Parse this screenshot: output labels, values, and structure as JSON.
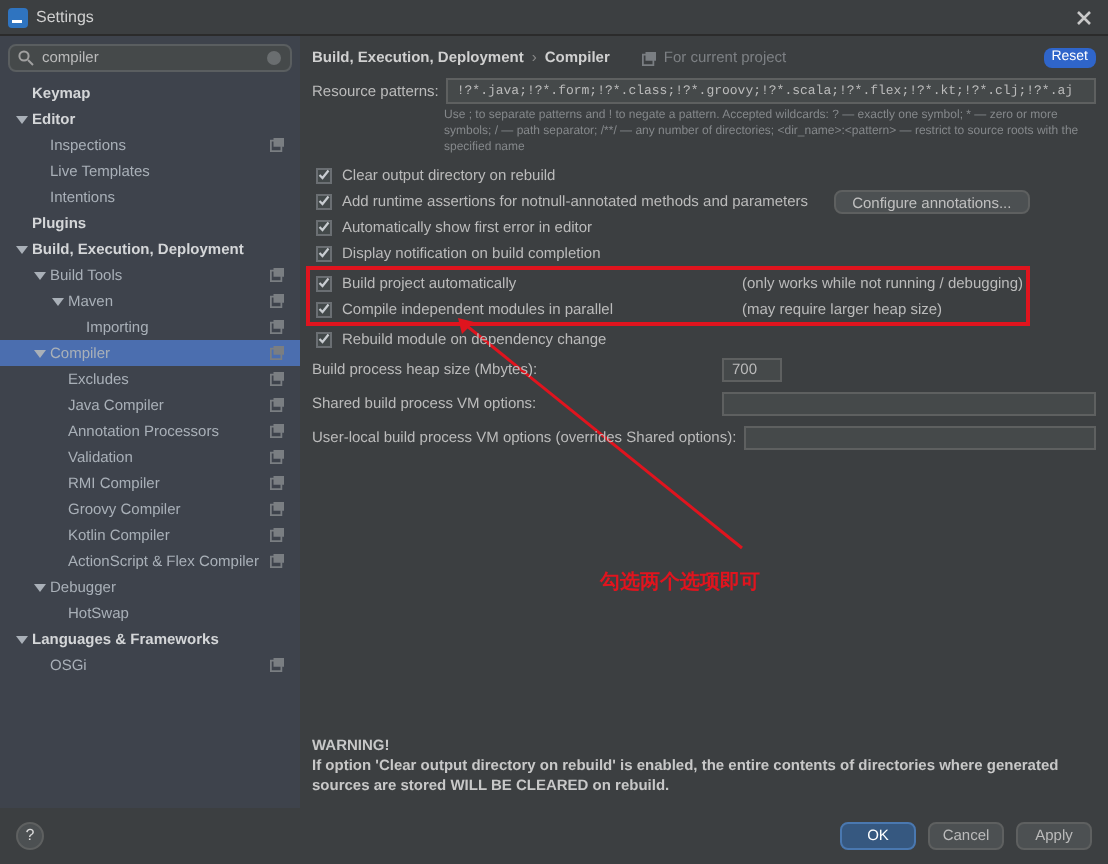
{
  "window": {
    "title": "Settings"
  },
  "search": {
    "value": "compiler"
  },
  "sidebar": {
    "items": [
      {
        "label": "Keymap",
        "bold": true,
        "selected": false,
        "project": false
      },
      {
        "label": "Editor",
        "bold": true,
        "selected": false,
        "project": false,
        "expanded": true,
        "children": [
          {
            "label": "Inspections",
            "selected": false,
            "project": true
          },
          {
            "label": "Live Templates",
            "selected": false,
            "project": false
          },
          {
            "label": "Intentions",
            "selected": false,
            "project": false
          }
        ]
      },
      {
        "label": "Plugins",
        "bold": true,
        "selected": false,
        "project": false
      },
      {
        "label": "Build, Execution, Deployment",
        "bold": true,
        "selected": false,
        "project": false,
        "expanded": true,
        "children": [
          {
            "label": "Build Tools",
            "selected": false,
            "project": true,
            "expanded": true,
            "children": [
              {
                "label": "Maven",
                "selected": false,
                "project": true,
                "expanded": true,
                "children": [
                  {
                    "label": "Importing",
                    "selected": false,
                    "project": true
                  }
                ]
              }
            ]
          },
          {
            "label": "Compiler",
            "selected": true,
            "project": true,
            "expanded": true,
            "children": [
              {
                "label": "Excludes",
                "selected": false,
                "project": true
              },
              {
                "label": "Java Compiler",
                "selected": false,
                "project": true
              },
              {
                "label": "Annotation Processors",
                "selected": false,
                "project": true
              },
              {
                "label": "Validation",
                "selected": false,
                "project": true
              },
              {
                "label": "RMI Compiler",
                "selected": false,
                "project": true
              },
              {
                "label": "Groovy Compiler",
                "selected": false,
                "project": true
              },
              {
                "label": "Kotlin Compiler",
                "selected": false,
                "project": true
              },
              {
                "label": "ActionScript & Flex Compiler",
                "selected": false,
                "project": true
              }
            ]
          },
          {
            "label": "Debugger",
            "selected": false,
            "project": false,
            "expanded": true,
            "children": [
              {
                "label": "HotSwap",
                "selected": false,
                "project": false
              }
            ]
          }
        ]
      },
      {
        "label": "Languages & Frameworks",
        "bold": true,
        "selected": false,
        "project": false,
        "expanded": true,
        "children": [
          {
            "label": "OSGi",
            "selected": false,
            "project": true
          }
        ]
      }
    ]
  },
  "breadcrumb": {
    "parent": "Build, Execution, Deployment",
    "separator": "›",
    "current": "Compiler",
    "scope": "For current project",
    "reset": "Reset"
  },
  "resource_patterns": {
    "label": "Resource patterns:",
    "value": "!?*.java;!?*.form;!?*.class;!?*.groovy;!?*.scala;!?*.flex;!?*.kt;!?*.clj;!?*.aj",
    "hint": "Use ; to separate patterns and ! to negate a pattern. Accepted wildcards: ? — exactly one symbol; * — zero or more symbols; / — path separator; /**/ — any number of directories; <dir_name>:<pattern> — restrict to source roots with the specified name"
  },
  "options": [
    {
      "label": "Clear output directory on rebuild",
      "checked": true,
      "highlighted": false
    },
    {
      "label": "Add runtime assertions for notnull-annotated methods and parameters",
      "checked": true,
      "highlighted": false,
      "button": "Configure annotations..."
    },
    {
      "label": "Automatically show first error in editor",
      "checked": true,
      "highlighted": false
    },
    {
      "label": "Display notification on build completion",
      "checked": true,
      "highlighted": false
    },
    {
      "label": "Build project automatically",
      "checked": true,
      "note": "(only works while not running / debugging)",
      "highlighted": true
    },
    {
      "label": "Compile independent modules in parallel",
      "checked": true,
      "note": "(may require larger heap size)",
      "highlighted": true
    },
    {
      "label": "Rebuild module on dependency change",
      "checked": true,
      "highlighted": false
    }
  ],
  "fields": [
    {
      "label": "Build process heap size (Mbytes):",
      "value": "700",
      "kind": "short"
    },
    {
      "label": "Shared build process VM options:",
      "kind": "wide"
    },
    {
      "label": "User-local build process VM options (overrides Shared options):",
      "kind": "wide"
    }
  ],
  "annotation": {
    "text": "勾选两个选项即可"
  },
  "warning": {
    "title": "WARNING!",
    "text": "If option 'Clear output directory on rebuild' is enabled, the entire contents of directories where generated sources are stored WILL BE CLEARED on rebuild."
  },
  "help": {
    "label": "?"
  },
  "buttons": [
    {
      "label": "OK",
      "primary": true
    },
    {
      "label": "Cancel",
      "primary": false
    },
    {
      "label": "Apply",
      "primary": false
    }
  ]
}
